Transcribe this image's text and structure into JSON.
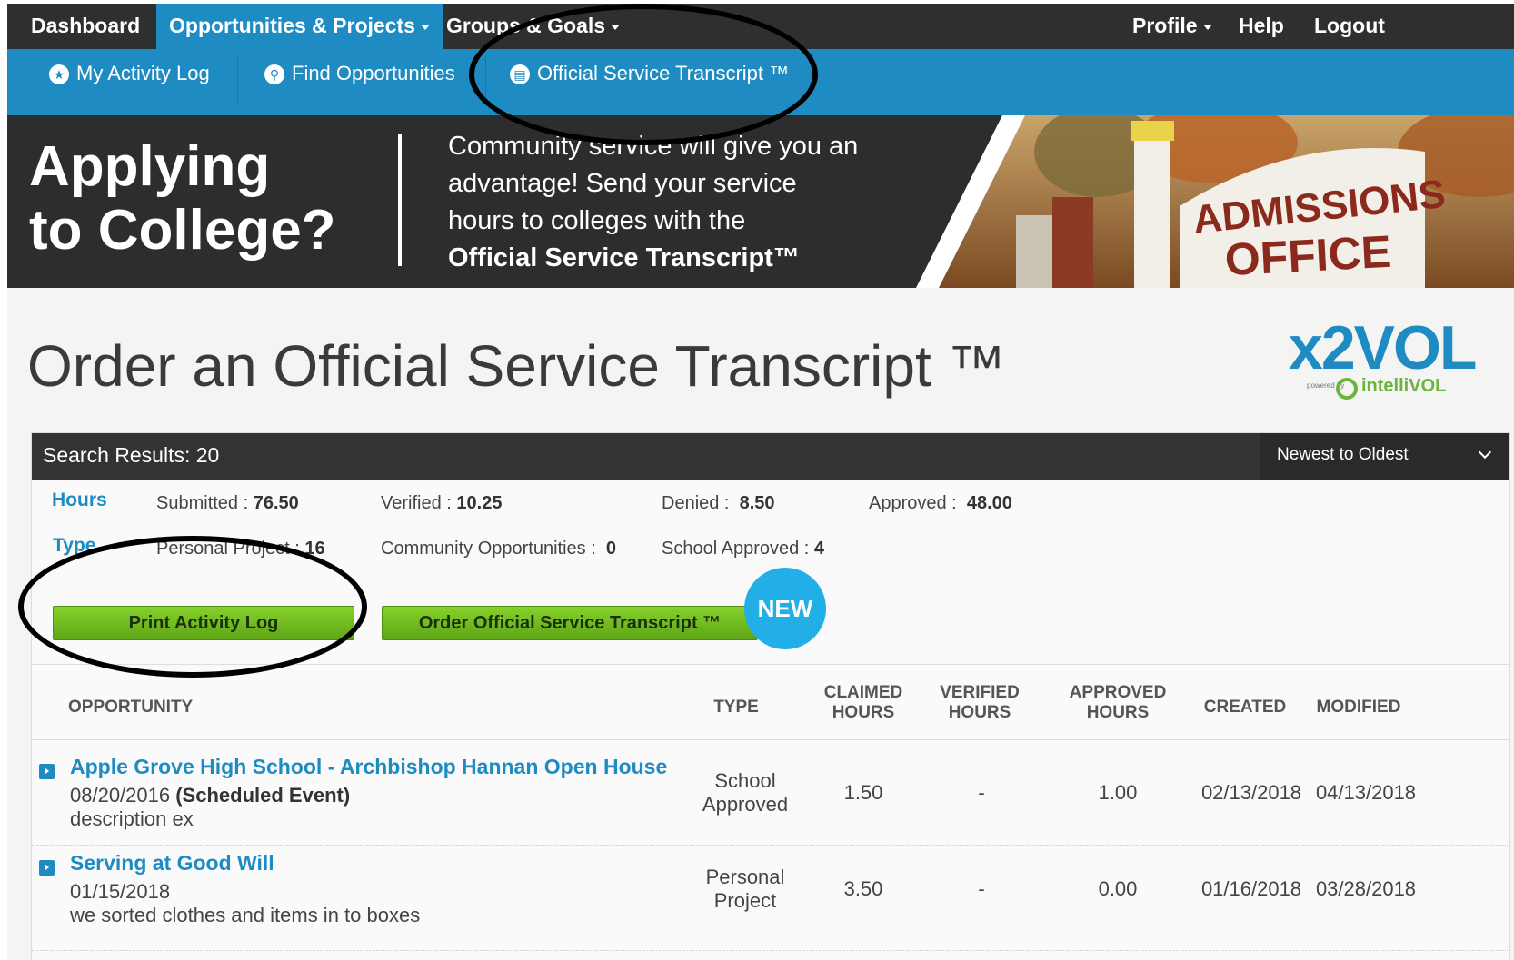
{
  "topnav": {
    "dashboard": "Dashboard",
    "opportunities": "Opportunities & Projects",
    "groups": "Groups & Goals",
    "profile": "Profile",
    "help": "Help",
    "logout": "Logout"
  },
  "subnav": {
    "activity_log": "My Activity Log",
    "find": "Find Opportunities",
    "transcript": "Official Service Transcript ™"
  },
  "banner": {
    "headline_1": "Applying",
    "headline_2": "to College?",
    "copy_1": "Community service will give you an",
    "copy_2": "advantage! Send your service",
    "copy_3": "hours to colleges with the",
    "copy_bold": "Official Service Transcript™",
    "sign_1": "ADMISSIONS",
    "sign_2": "OFFICE"
  },
  "page": {
    "title": "Order an Official Service Transcript ™"
  },
  "logo": {
    "main": "x2VOL",
    "powered_by": "powered by",
    "intellivol": "intelliVOL"
  },
  "results": {
    "count_label": "Search Results: 20",
    "sort_selected": "Newest to Oldest"
  },
  "stats": {
    "hours_label": "Hours",
    "type_label": "Type",
    "submitted_label": "Submitted :",
    "submitted": "76.50",
    "verified_label": "Verified :",
    "verified": "10.25",
    "denied_label": "Denied :",
    "denied": "8.50",
    "approved_label": "Approved :",
    "approved": "48.00",
    "personal_label": "Personal Project :",
    "personal": "16",
    "community_label": "Community Opportunities :",
    "community": "0",
    "school_label": "School Approved :",
    "school": "4"
  },
  "buttons": {
    "print": "Print Activity Log",
    "order": "Order Official Service Transcript ™",
    "new_badge": "NEW"
  },
  "table": {
    "columns": {
      "opportunity": "OPPORTUNITY",
      "type": "TYPE",
      "claimed_1": "CLAIMED",
      "claimed_2": "HOURS",
      "verified_1": "VERIFIED",
      "verified_2": "HOURS",
      "approved_1": "APPROVED",
      "approved_2": "HOURS",
      "created": "CREATED",
      "modified": "MODIFIED"
    },
    "rows": [
      {
        "title": "Apple Grove High School  -   Archbishop Hannan Open House",
        "date": "08/20/2016",
        "event": "(Scheduled Event)",
        "description": "description ex",
        "type_1": "School",
        "type_2": "Approved",
        "claimed": "1.50",
        "verified": "-",
        "approved": "1.00",
        "created": "02/13/2018",
        "modified": "04/13/2018"
      },
      {
        "title": "Serving at Good Will",
        "date": "01/15/2018",
        "event": "",
        "description": "we sorted clothes and items in to boxes",
        "type_1": "Personal",
        "type_2": "Project",
        "claimed": "3.50",
        "verified": "-",
        "approved": "0.00",
        "created": "01/16/2018",
        "modified": "03/28/2018"
      }
    ]
  },
  "colors": {
    "nav_dark": "#2f2f2f",
    "accent_blue": "#1e8bc3",
    "button_green": "#6cbf22",
    "badge_blue": "#22aee7"
  }
}
